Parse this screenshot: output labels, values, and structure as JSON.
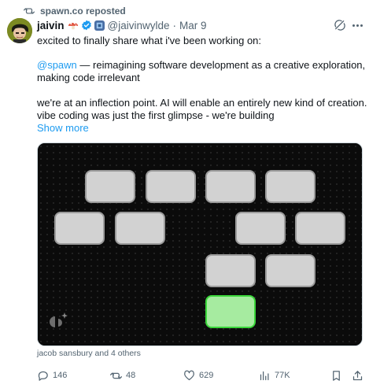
{
  "repost": {
    "text": "spawn.co reposted"
  },
  "post": {
    "author_name": "jaivin",
    "handle": "@jaivinwylde",
    "separator": "·",
    "date": "Mar 9",
    "line1": "excited to finally share what i've been working on:",
    "mention": "@spawn",
    "line2_rest": " — reimagining software development as a creative exploration,",
    "line3": "making code irrelevant",
    "line4": "we're at an inflection point. AI will enable an entirely new kind of creation.",
    "line5": "vibe coding was just the first glimpse - we're building",
    "show_more": "Show more"
  },
  "media": {
    "active_tile_color": "#a6eba0",
    "tile_color": "#d2d2d2"
  },
  "liked_by": "jacob sansbury and 4 others",
  "actions": {
    "replies": "146",
    "reposts": "48",
    "likes": "629",
    "views": "77K"
  },
  "colors": {
    "accent": "#1d9bf0",
    "muted": "#536471",
    "text": "#0f1419"
  }
}
